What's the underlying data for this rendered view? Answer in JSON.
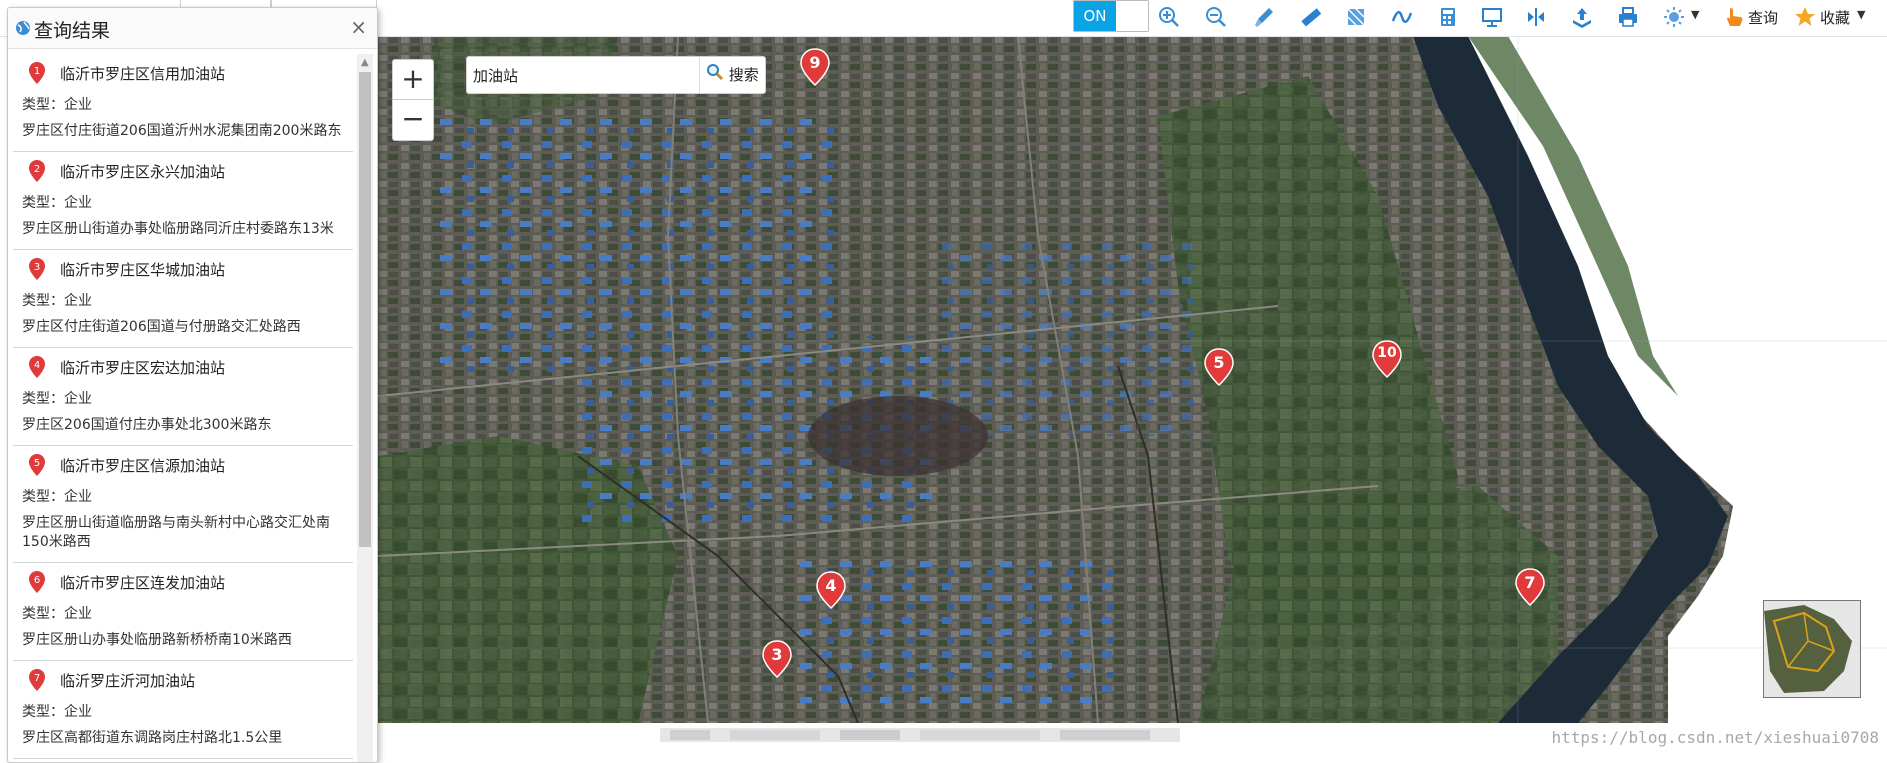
{
  "toolbar": {
    "toggle_label": "ON",
    "query_label": "查询",
    "favorites_label": "收藏",
    "tools": [
      "zoom-in-icon",
      "zoom-out-icon",
      "brush-icon",
      "ruler-icon",
      "area-measure-icon",
      "curve-icon",
      "calculator-icon",
      "screen-icon",
      "split-icon",
      "export-icon",
      "print-icon",
      "light-icon"
    ]
  },
  "panel": {
    "title": "查询结果",
    "close": "×",
    "results": [
      {
        "num": "1",
        "name": "临沂市罗庄区信用加油站",
        "type": "类型：企业",
        "address": "罗庄区付庄街道206国道沂州水泥集团南200米路东"
      },
      {
        "num": "2",
        "name": "临沂市罗庄区永兴加油站",
        "type": "类型：企业",
        "address": "罗庄区册山街道办事处临册路同沂庄村委路东13米"
      },
      {
        "num": "3",
        "name": "临沂市罗庄区华城加油站",
        "type": "类型：企业",
        "address": "罗庄区付庄街道206国道与付册路交汇处路西"
      },
      {
        "num": "4",
        "name": "临沂市罗庄区宏达加油站",
        "type": "类型：企业",
        "address": "罗庄区206国道付庄办事处北300米路东"
      },
      {
        "num": "5",
        "name": "临沂市罗庄区信源加油站",
        "type": "类型：企业",
        "address": "罗庄区册山街道临册路与南头新村中心路交汇处南150米路西"
      },
      {
        "num": "6",
        "name": "临沂市罗庄区连发加油站",
        "type": "类型：企业",
        "address": "罗庄区册山办事处临册路新桥桥南10米路西"
      },
      {
        "num": "7",
        "name": "临沂罗庄沂河加油站",
        "type": "类型：企业",
        "address": "罗庄区高都街道东调路岗庄村路北1.5公里"
      }
    ]
  },
  "map": {
    "zoom_in": "+",
    "zoom_out": "−",
    "search_value": "加油站",
    "search_button": "搜索",
    "markers": [
      "9",
      "5",
      "10",
      "4",
      "3",
      "7"
    ],
    "watermark": "https://blog.csdn.net/xieshuai0708",
    "colors": {
      "marker": "#e03a3a",
      "toggle": "#0aa3e6",
      "river": "#1d2a38",
      "urban": "#6f6f66",
      "farmland": "#3f5a34"
    }
  }
}
